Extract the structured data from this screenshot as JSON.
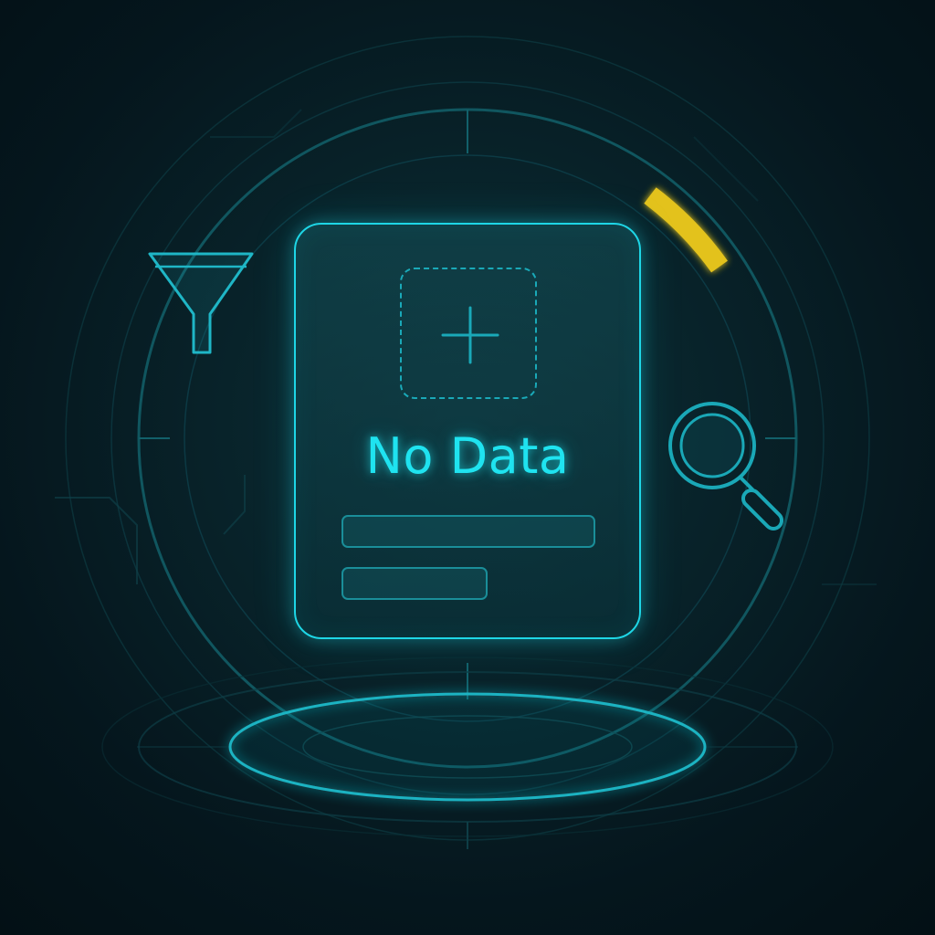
{
  "empty_state": {
    "title": "No Data"
  },
  "icons": {
    "add": "plus-icon",
    "filter": "funnel-icon",
    "search": "magnifier-icon"
  },
  "colors": {
    "background": "#05161d",
    "accent": "#1ed6e6",
    "accent_dim": "#1a8e99",
    "highlight": "#e3c21d"
  }
}
